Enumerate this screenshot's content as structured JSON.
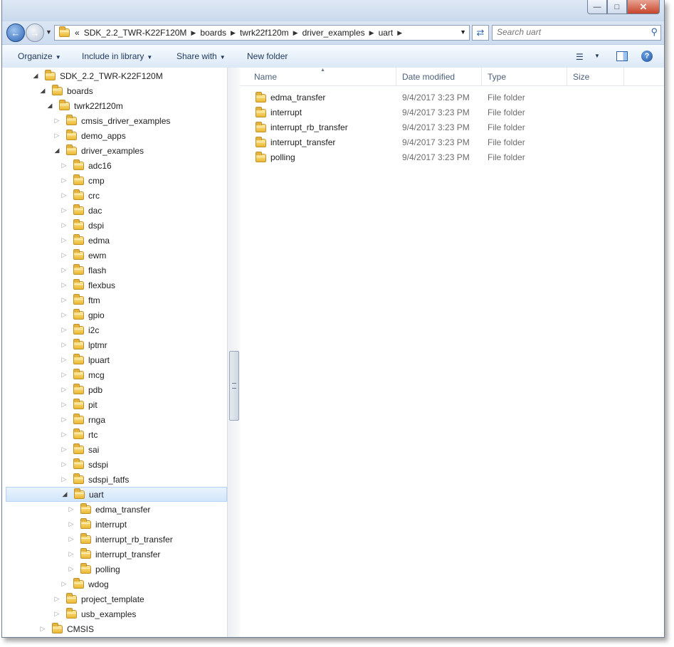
{
  "address": {
    "overflow_marker": "«",
    "crumbs": [
      "SDK_2.2_TWR-K22F120M",
      "boards",
      "twrk22f120m",
      "driver_examples",
      "uart"
    ]
  },
  "search": {
    "placeholder": "Search uart"
  },
  "toolbar": {
    "organize": "Organize",
    "include_in_library": "Include in library",
    "share_with": "Share with",
    "new_folder": "New folder"
  },
  "columns": {
    "name": "Name",
    "date": "Date modified",
    "type": "Type",
    "size": "Size"
  },
  "files": [
    {
      "name": "edma_transfer",
      "date": "9/4/2017 3:23 PM",
      "type": "File folder"
    },
    {
      "name": "interrupt",
      "date": "9/4/2017 3:23 PM",
      "type": "File folder"
    },
    {
      "name": "interrupt_rb_transfer",
      "date": "9/4/2017 3:23 PM",
      "type": "File folder"
    },
    {
      "name": "interrupt_transfer",
      "date": "9/4/2017 3:23 PM",
      "type": "File folder"
    },
    {
      "name": "polling",
      "date": "9/4/2017 3:23 PM",
      "type": "File folder"
    }
  ],
  "tree": [
    {
      "label": "SDK_2.2_TWR-K22F120M",
      "depth": 0,
      "expanded": true
    },
    {
      "label": "boards",
      "depth": 1,
      "expanded": true
    },
    {
      "label": "twrk22f120m",
      "depth": 2,
      "expanded": true
    },
    {
      "label": "cmsis_driver_examples",
      "depth": 3,
      "expanded": false
    },
    {
      "label": "demo_apps",
      "depth": 3,
      "expanded": false
    },
    {
      "label": "driver_examples",
      "depth": 3,
      "expanded": true
    },
    {
      "label": "adc16",
      "depth": 4,
      "expanded": false
    },
    {
      "label": "cmp",
      "depth": 4,
      "expanded": false
    },
    {
      "label": "crc",
      "depth": 4,
      "expanded": false
    },
    {
      "label": "dac",
      "depth": 4,
      "expanded": false
    },
    {
      "label": "dspi",
      "depth": 4,
      "expanded": false
    },
    {
      "label": "edma",
      "depth": 4,
      "expanded": false
    },
    {
      "label": "ewm",
      "depth": 4,
      "expanded": false
    },
    {
      "label": "flash",
      "depth": 4,
      "expanded": false
    },
    {
      "label": "flexbus",
      "depth": 4,
      "expanded": false
    },
    {
      "label": "ftm",
      "depth": 4,
      "expanded": false
    },
    {
      "label": "gpio",
      "depth": 4,
      "expanded": false
    },
    {
      "label": "i2c",
      "depth": 4,
      "expanded": false
    },
    {
      "label": "lptmr",
      "depth": 4,
      "expanded": false
    },
    {
      "label": "lpuart",
      "depth": 4,
      "expanded": false
    },
    {
      "label": "mcg",
      "depth": 4,
      "expanded": false
    },
    {
      "label": "pdb",
      "depth": 4,
      "expanded": false
    },
    {
      "label": "pit",
      "depth": 4,
      "expanded": false
    },
    {
      "label": "rnga",
      "depth": 4,
      "expanded": false
    },
    {
      "label": "rtc",
      "depth": 4,
      "expanded": false
    },
    {
      "label": "sai",
      "depth": 4,
      "expanded": false
    },
    {
      "label": "sdspi",
      "depth": 4,
      "expanded": false
    },
    {
      "label": "sdspi_fatfs",
      "depth": 4,
      "expanded": false
    },
    {
      "label": "uart",
      "depth": 4,
      "expanded": true,
      "selected": true
    },
    {
      "label": "edma_transfer",
      "depth": 5,
      "expanded": false
    },
    {
      "label": "interrupt",
      "depth": 5,
      "expanded": false
    },
    {
      "label": "interrupt_rb_transfer",
      "depth": 5,
      "expanded": false
    },
    {
      "label": "interrupt_transfer",
      "depth": 5,
      "expanded": false
    },
    {
      "label": "polling",
      "depth": 5,
      "expanded": false
    },
    {
      "label": "wdog",
      "depth": 4,
      "expanded": false
    },
    {
      "label": "project_template",
      "depth": 3,
      "expanded": false
    },
    {
      "label": "usb_examples",
      "depth": 3,
      "expanded": false
    },
    {
      "label": "CMSIS",
      "depth": 1,
      "expanded": false
    }
  ]
}
